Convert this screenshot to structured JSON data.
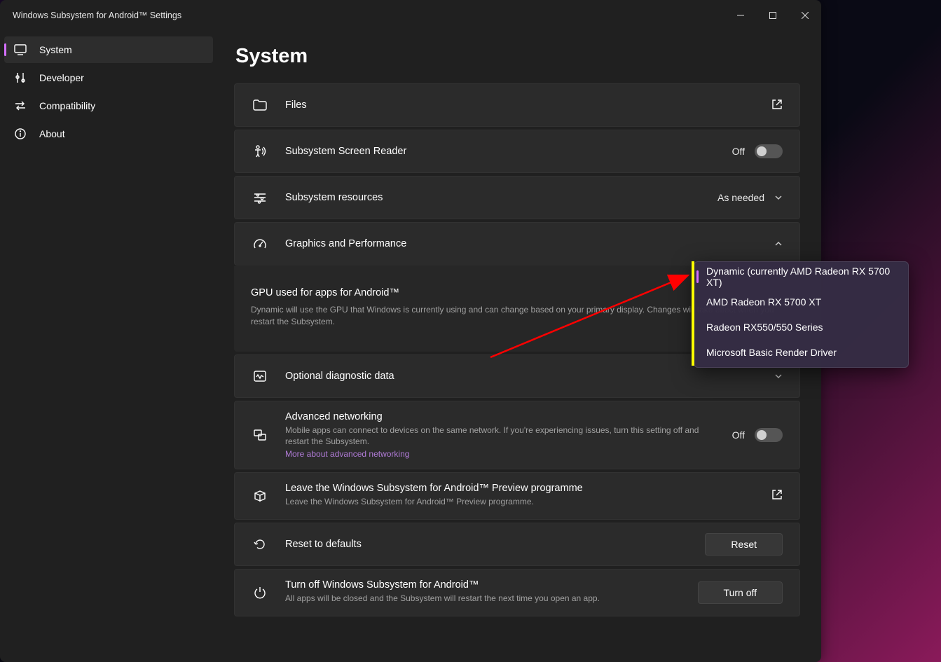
{
  "window_title": "Windows Subsystem for Android™ Settings",
  "sidebar": {
    "items": [
      {
        "label": "System"
      },
      {
        "label": "Developer"
      },
      {
        "label": "Compatibility"
      },
      {
        "label": "About"
      }
    ]
  },
  "page_title": "System",
  "files": {
    "label": "Files"
  },
  "screen_reader": {
    "label": "Subsystem Screen Reader",
    "state": "Off"
  },
  "resources": {
    "label": "Subsystem resources",
    "value": "As needed"
  },
  "graphics": {
    "label": "Graphics and Performance",
    "panel_heading": "GPU used for apps for Android™",
    "panel_desc": "Dynamic will use the GPU that Windows is currently using and can change based on your primary display. Changes will take effect when you restart the Subsystem."
  },
  "diagnostic": {
    "label": "Optional diagnostic data"
  },
  "networking": {
    "label": "Advanced networking",
    "desc": "Mobile apps can connect to devices on the same network. If you're experiencing issues, turn this setting off and restart the Subsystem.",
    "link": "More about advanced networking",
    "state": "Off"
  },
  "preview": {
    "label": "Leave the Windows Subsystem for Android™ Preview programme",
    "desc": "Leave the Windows Subsystem for Android™ Preview programme."
  },
  "reset": {
    "label": "Reset to defaults",
    "button": "Reset"
  },
  "turnoff": {
    "label": "Turn off Windows Subsystem for Android™",
    "desc": "All apps will be closed and the Subsystem will restart the next time you open an app.",
    "button": "Turn off"
  },
  "dropdown": {
    "items": [
      {
        "label": "Dynamic (currently AMD Radeon RX 5700 XT)"
      },
      {
        "label": "AMD Radeon RX 5700 XT"
      },
      {
        "label": "Radeon RX550/550 Series"
      },
      {
        "label": "Microsoft Basic Render Driver"
      }
    ]
  }
}
